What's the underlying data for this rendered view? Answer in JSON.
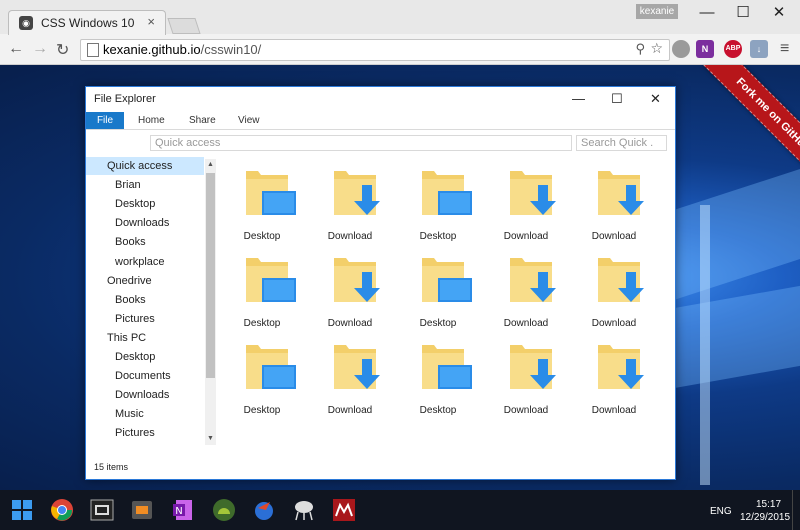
{
  "browser": {
    "tab_title": "CSS Windows 10",
    "tab_close": "×",
    "profile_name": "kexanie",
    "window_minimize": "—",
    "window_maximize": "☐",
    "window_close": "✕",
    "url_host": "kexanie.github.io",
    "url_path": "/csswin10/",
    "back_icon": "←",
    "forward_icon": "→",
    "reload_icon": "↻",
    "zoom_icon": "⚲",
    "star_icon": "☆",
    "menu_icon": "≡",
    "ext_onenote_label": "N",
    "ext_abp_label": "ABP",
    "ext_download_label": "↓"
  },
  "ribbon": {
    "text": "Fork me on GitHub",
    "color": "#b7161a"
  },
  "explorer": {
    "title": "File Explorer",
    "minimize": "—",
    "maximize": "☐",
    "close": "✕",
    "tabs": [
      "File",
      "Home",
      "Share",
      "View"
    ],
    "address_placeholder": "Quick access",
    "search_placeholder": "Search Quick .",
    "nav": [
      {
        "label": "Quick access",
        "level": 0,
        "selected": true
      },
      {
        "label": "Brian",
        "level": 1
      },
      {
        "label": "Desktop",
        "level": 1
      },
      {
        "label": "Downloads",
        "level": 1
      },
      {
        "label": "Books",
        "level": 1
      },
      {
        "label": "workplace",
        "level": 1
      },
      {
        "label": "Onedrive",
        "level": 0
      },
      {
        "label": "Books",
        "level": 1
      },
      {
        "label": "Pictures",
        "level": 1
      },
      {
        "label": "This PC",
        "level": 0
      },
      {
        "label": "Desktop",
        "level": 1
      },
      {
        "label": "Documents",
        "level": 1
      },
      {
        "label": "Downloads",
        "level": 1
      },
      {
        "label": "Music",
        "level": 1
      },
      {
        "label": "Pictures",
        "level": 1
      }
    ],
    "files": [
      {
        "label": "Desktop",
        "icon": "folder-desktop-icon"
      },
      {
        "label": "Download",
        "icon": "folder-download-icon"
      },
      {
        "label": "Desktop",
        "icon": "folder-desktop-icon"
      },
      {
        "label": "Download",
        "icon": "folder-download-icon"
      },
      {
        "label": "Download",
        "icon": "folder-download-icon"
      },
      {
        "label": "Desktop",
        "icon": "folder-desktop-icon"
      },
      {
        "label": "Download",
        "icon": "folder-download-icon"
      },
      {
        "label": "Desktop",
        "icon": "folder-desktop-icon"
      },
      {
        "label": "Download",
        "icon": "folder-download-icon"
      },
      {
        "label": "Download",
        "icon": "folder-download-icon"
      },
      {
        "label": "Desktop",
        "icon": "folder-desktop-icon"
      },
      {
        "label": "Download",
        "icon": "folder-download-icon"
      },
      {
        "label": "Desktop",
        "icon": "folder-desktop-icon"
      },
      {
        "label": "Download",
        "icon": "folder-download-icon"
      },
      {
        "label": "Download",
        "icon": "folder-download-icon"
      }
    ],
    "status": "15 items"
  },
  "taskbar": {
    "lang": "ENG",
    "time": "15:17",
    "date": "12/29/2015",
    "apps": [
      "chrome-icon",
      "terminal-icon",
      "sublime-icon",
      "onenote-icon",
      "android-studio-icon",
      "bird-icon",
      "network-icon",
      "mendeley-icon"
    ]
  },
  "colors": {
    "accent": "#1979ca",
    "folder": "#f3cf6a",
    "overlay": "#2a8ce8"
  }
}
